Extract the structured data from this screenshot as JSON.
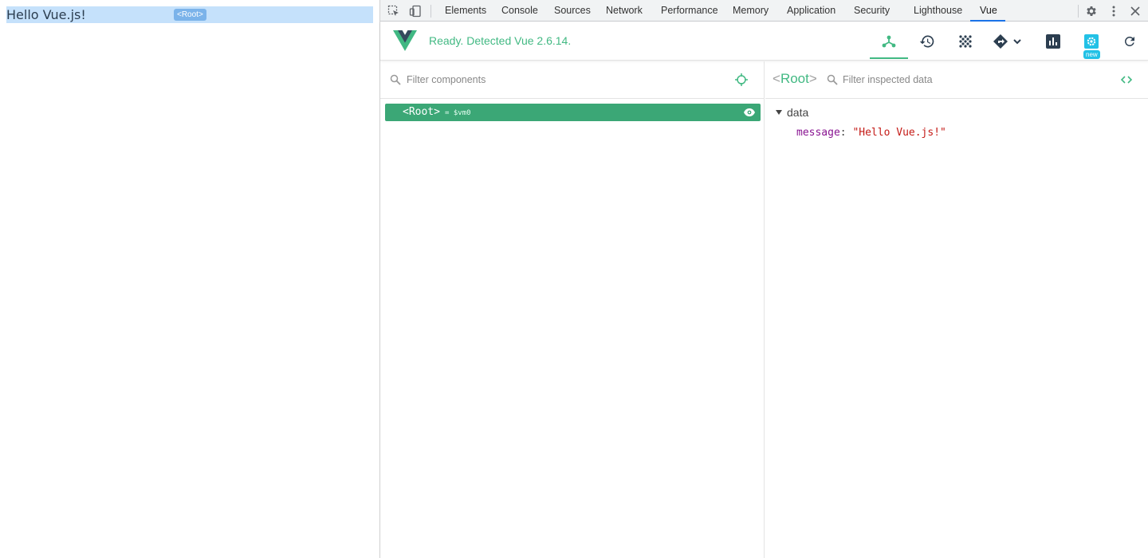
{
  "page": {
    "text": "Hello Vue.js!",
    "component_tag": "<Root>"
  },
  "devtools": {
    "tabs": [
      "Elements",
      "Console",
      "Sources",
      "Network",
      "Performance",
      "Memory",
      "Application",
      "Security",
      "Lighthouse",
      "Vue"
    ],
    "active_tab": "Vue",
    "toolbar_icons": [
      "inspect-element-icon",
      "device-toolbar-icon",
      "settings-gear-icon",
      "more-vert-icon",
      "close-icon"
    ]
  },
  "vue": {
    "status": "Ready. Detected Vue 2.6.14.",
    "header_buttons": [
      "components-tree-icon",
      "history-icon",
      "vuex-icon",
      "router-icon",
      "performance-icon",
      "settings-icon",
      "refresh-icon"
    ],
    "new_badge": "new",
    "components": {
      "filter_placeholder": "Filter components",
      "tree": [
        {
          "name": "<Root>",
          "var": "= $vm0"
        }
      ]
    },
    "inspector": {
      "title_open": "<",
      "title_name": "Root",
      "title_close": ">",
      "filter_placeholder": "Filter inspected data",
      "section": "data",
      "props": [
        {
          "key": "message",
          "value": "\"Hello Vue.js!\""
        }
      ]
    },
    "colors": {
      "accent": "#42b983",
      "row_selected": "#3ba776"
    }
  }
}
